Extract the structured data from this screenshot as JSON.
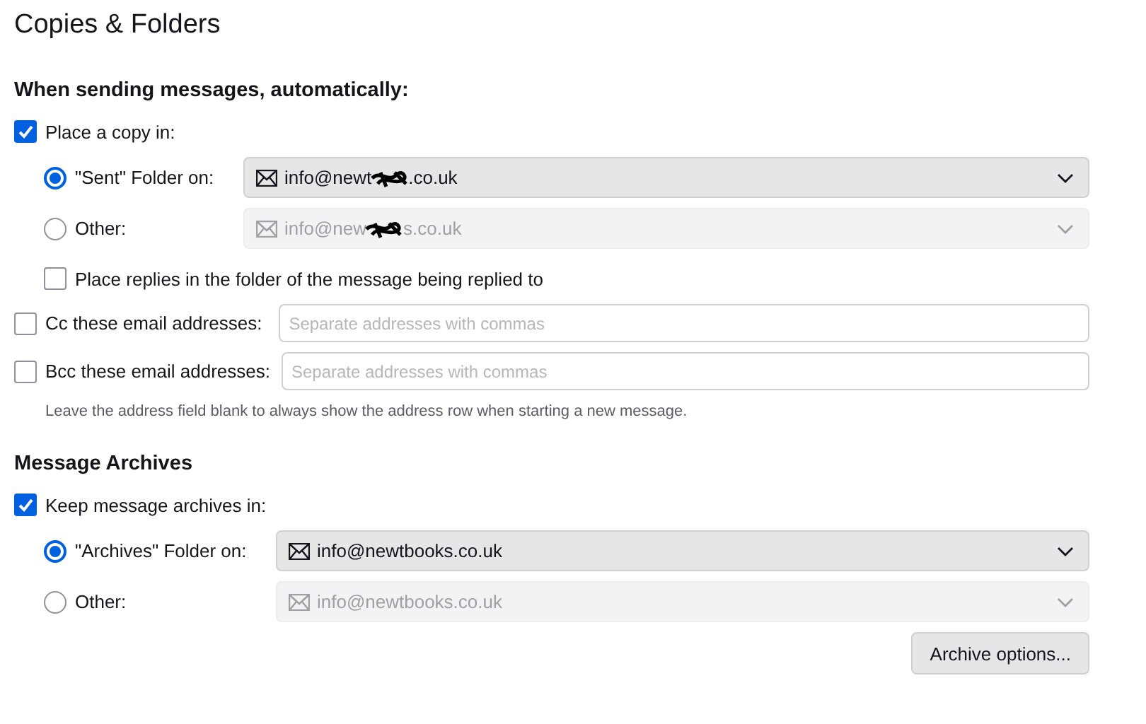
{
  "title": "Copies & Folders",
  "sending": {
    "heading": "When sending messages, automatically:",
    "place_copy": {
      "label": "Place a copy in:",
      "checked": true
    },
    "folder_options": [
      {
        "label": "\"Sent\" Folder on:",
        "selected": true,
        "disabled": false,
        "value_parts": [
          "info@newt",
          ".co.uk"
        ]
      },
      {
        "label": "Other:",
        "selected": false,
        "disabled": true,
        "value_parts": [
          "info@new",
          "s.co.uk"
        ]
      }
    ],
    "reply_in_folder": {
      "label": "Place replies in the folder of the message being replied to",
      "checked": false
    },
    "address_fields": [
      {
        "label": "Cc these email addresses:",
        "checked": false,
        "placeholder": "Separate addresses with commas"
      },
      {
        "label": "Bcc these email addresses:",
        "checked": false,
        "placeholder": "Separate addresses with commas"
      }
    ],
    "hint": "Leave the address field blank to always show the address row when starting a new message."
  },
  "archives": {
    "heading": "Message Archives",
    "keep": {
      "label": "Keep message archives in:",
      "checked": true
    },
    "folder_options": [
      {
        "label": "\"Archives\" Folder on:",
        "selected": true,
        "disabled": false,
        "value_parts": [
          "info@newtbooks.co.uk"
        ]
      },
      {
        "label": "Other:",
        "selected": false,
        "disabled": true,
        "value_parts": [
          "info@newtbooks.co.uk"
        ]
      }
    ],
    "button": "Archive options..."
  }
}
